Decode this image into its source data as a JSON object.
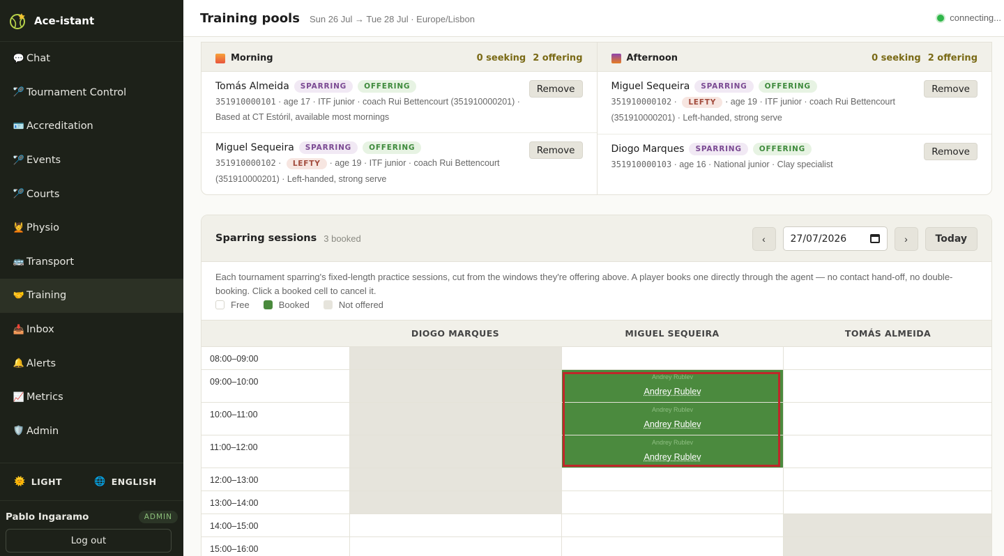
{
  "app": {
    "name": "Ace-istant"
  },
  "sidebar": {
    "items": [
      {
        "icon": "speech-bubble-icon",
        "glyph": "💬",
        "label": "Chat"
      },
      {
        "icon": "racket-icon",
        "glyph": "🏸",
        "label": "Tournament Control"
      },
      {
        "icon": "id-card-icon",
        "glyph": "🪪",
        "label": "Accreditation"
      },
      {
        "icon": "racket-icon",
        "glyph": "🏸",
        "label": "Events"
      },
      {
        "icon": "racket-icon",
        "glyph": "🏸",
        "label": "Courts"
      },
      {
        "icon": "physio-icon",
        "glyph": "💆",
        "label": "Physio"
      },
      {
        "icon": "bus-icon",
        "glyph": "🚌",
        "label": "Transport"
      },
      {
        "icon": "handshake-icon",
        "glyph": "🤝",
        "label": "Training"
      },
      {
        "icon": "inbox-icon",
        "glyph": "📥",
        "label": "Inbox"
      },
      {
        "icon": "bell-icon",
        "glyph": "🔔",
        "label": "Alerts"
      },
      {
        "icon": "chart-icon",
        "glyph": "📈",
        "label": "Metrics"
      },
      {
        "icon": "shield-icon",
        "glyph": "🛡️",
        "label": "Admin"
      }
    ],
    "theme_label": "LIGHT",
    "language_label": "ENGLISH",
    "user_name": "Pablo Ingaramo",
    "user_role": "ADMIN",
    "logout_label": "Log out"
  },
  "header": {
    "title": "Training pools",
    "subtitle": "Sun 26 Jul → Tue 28 Jul · Europe/Lisbon",
    "status": "connecting..."
  },
  "pools": [
    {
      "title": "Morning",
      "icon": "sunrise-icon",
      "seeking": "0 seeking",
      "offering": "2 offering",
      "entries": [
        {
          "name": "Tomás Almeida",
          "tags": [
            "SPARRING",
            "OFFERING"
          ],
          "phone": "351910000101",
          "lefty": "",
          "detail": " · age 17 · ITF junior · coach Rui Bettencourt (351910000201) · Based at CT Estóril, available most mornings"
        },
        {
          "name": "Miguel Sequeira",
          "tags": [
            "SPARRING",
            "OFFERING"
          ],
          "phone": "351910000102",
          "lefty": "LEFTY",
          "detail": "· age 19 · ITF junior · coach Rui Bettencourt (351910000201) · Left-handed, strong serve"
        }
      ]
    },
    {
      "title": "Afternoon",
      "icon": "sunset-icon",
      "seeking": "0 seeking",
      "offering": "2 offering",
      "entries": [
        {
          "name": "Miguel Sequeira",
          "tags": [
            "SPARRING",
            "OFFERING"
          ],
          "phone": "351910000102",
          "lefty": "LEFTY",
          "detail": "· age 19 · ITF junior · coach Rui Bettencourt (351910000201) · Left-handed, strong serve"
        },
        {
          "name": "Diogo Marques",
          "tags": [
            "SPARRING",
            "OFFERING"
          ],
          "phone": "351910000103",
          "lefty": "",
          "detail": " · age 16 · National junior · Clay specialist"
        }
      ]
    }
  ],
  "remove_label": "Remove",
  "sessions": {
    "title": "Sparring sessions",
    "count": "3 booked",
    "date": "27/07/2026",
    "prev": "‹",
    "next": "›",
    "today_label": "Today",
    "description": "Each tournament sparring's fixed-length practice sessions, cut from the windows they're offering above. A player books one directly through the agent — no contact hand-off, no double-booking. Click a booked cell to cancel it.",
    "legend": {
      "free": "Free",
      "booked": "Booked",
      "not_offered": "Not offered"
    },
    "columns": [
      "DIOGO MARQUES",
      "MIGUEL SEQUEIRA",
      "TOMÁS ALMEIDA"
    ],
    "rows": [
      {
        "time": "08:00–09:00",
        "cells": [
          "not",
          "free",
          "free"
        ]
      },
      {
        "time": "09:00–10:00",
        "cells": [
          "not",
          "booked",
          "free"
        ]
      },
      {
        "time": "10:00–11:00",
        "cells": [
          "not",
          "booked",
          "free"
        ]
      },
      {
        "time": "11:00–12:00",
        "cells": [
          "not",
          "booked",
          "free"
        ]
      },
      {
        "time": "12:00–13:00",
        "cells": [
          "not",
          "free",
          "free"
        ]
      },
      {
        "time": "13:00–14:00",
        "cells": [
          "not",
          "free",
          "free"
        ]
      },
      {
        "time": "14:00–15:00",
        "cells": [
          "free",
          "free",
          "not"
        ]
      },
      {
        "time": "15:00–16:00",
        "cells": [
          "free",
          "free",
          "not"
        ]
      }
    ],
    "booked_by": "Andrey Rublev"
  },
  "colors": {
    "sidebar_bg": "#1d2119",
    "booked": "#4b8a3e",
    "accent_gold": "#7a6a16",
    "status_green": "#2fb64a",
    "highlight_red": "#c0262a"
  }
}
